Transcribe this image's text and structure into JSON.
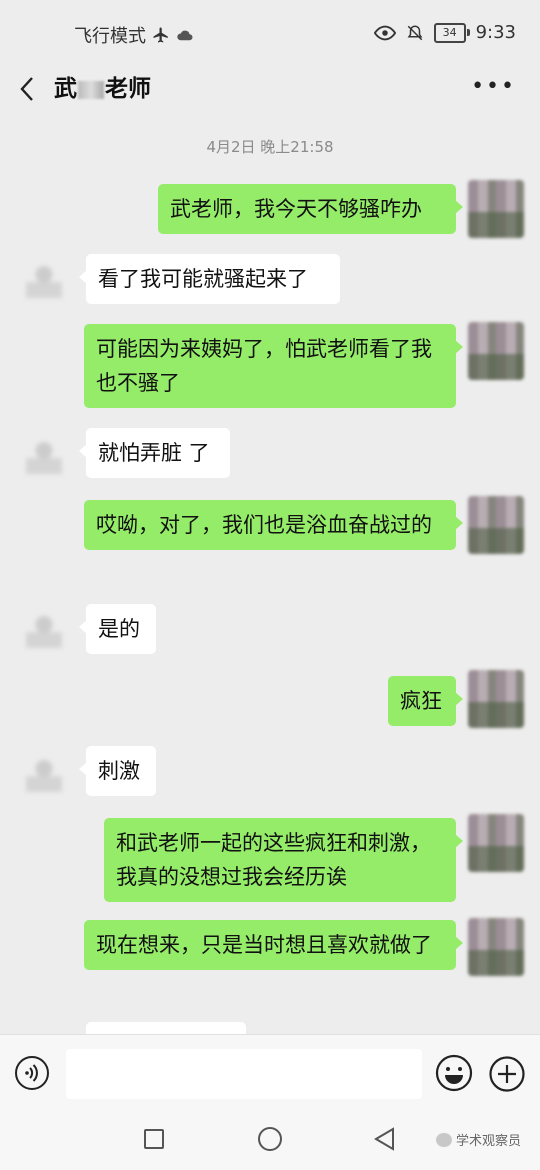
{
  "status_bar": {
    "mode": "飞行模式",
    "battery": "34",
    "time": "9:33"
  },
  "header": {
    "title_part1": "武",
    "title_part2": "老师",
    "more": "•••"
  },
  "timestamp": "4月2日 晚上21:58",
  "messages": [
    {
      "from": "me",
      "text": "武老师，我今天不够骚咋办"
    },
    {
      "from": "them",
      "text": "看了我可能就骚起来了"
    },
    {
      "from": "me",
      "text": "可能因为来姨妈了，怕武老师看了我也不骚了"
    },
    {
      "from": "them",
      "text": "就怕弄脏 了"
    },
    {
      "from": "me",
      "text": "哎呦，对了，我们也是浴血奋战过的"
    },
    {
      "from": "them",
      "text": "是的"
    },
    {
      "from": "me",
      "text": "疯狂"
    },
    {
      "from": "them",
      "text": "刺激"
    },
    {
      "from": "me",
      "text": "和武老师一起的这些疯狂和刺激，我真的没想过我会经历诶"
    },
    {
      "from": "me",
      "text": "现在想来，只是当时想且喜欢就做了"
    }
  ],
  "watermark": "学术观察员",
  "colors": {
    "my_bubble": "#95ec69",
    "their_bubble": "#ffffff",
    "background": "#ededed"
  }
}
